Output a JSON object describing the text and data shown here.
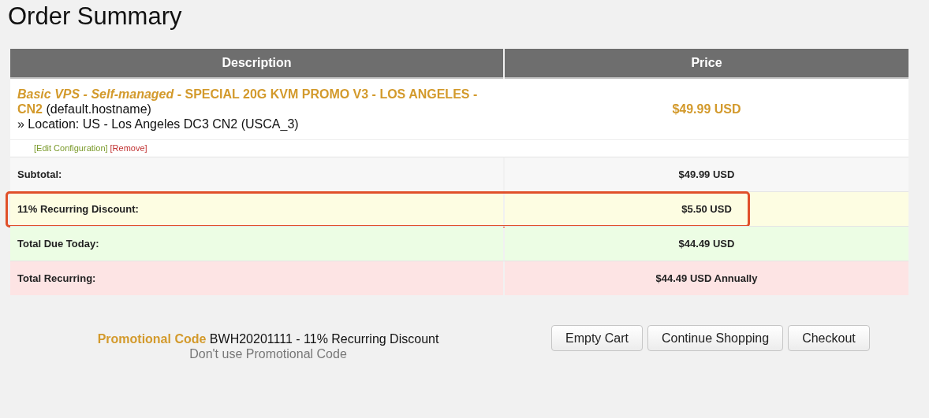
{
  "page_title": "Order Summary",
  "table": {
    "columns": [
      "Description",
      "Price"
    ],
    "item": {
      "product_name": "*Basic VPS - Self-managed* - SPECIAL 20G KVM PROMO V3 - LOS ANGELES - CN2",
      "hostname": "(default.hostname)",
      "location": "» Location: US - Los Angeles DC3 CN2 (USCA_3)",
      "price": "$49.99 USD",
      "edit_link": "[Edit Configuration]",
      "remove_link": "[Remove]"
    },
    "summary_rows": [
      {
        "kind": "subtotal",
        "label": "Subtotal:",
        "value": "$49.99 USD",
        "highlighted": false
      },
      {
        "kind": "discount",
        "label": "11% Recurring Discount:",
        "value": "$5.50 USD",
        "highlighted": true
      },
      {
        "kind": "total_due",
        "label": "Total Due Today:",
        "value": "$44.49 USD",
        "highlighted": false
      },
      {
        "kind": "recurring",
        "label": "Total Recurring:",
        "value": "$44.49 USD Annually",
        "highlighted": false
      }
    ]
  },
  "promo": {
    "label": "Promotional Code",
    "code": "BWH20201111 - 11% Recurring Discount",
    "remove_link": "Don't use Promotional Code"
  },
  "buttons": [
    "Empty Cart",
    "Continue Shopping",
    "Checkout"
  ]
}
